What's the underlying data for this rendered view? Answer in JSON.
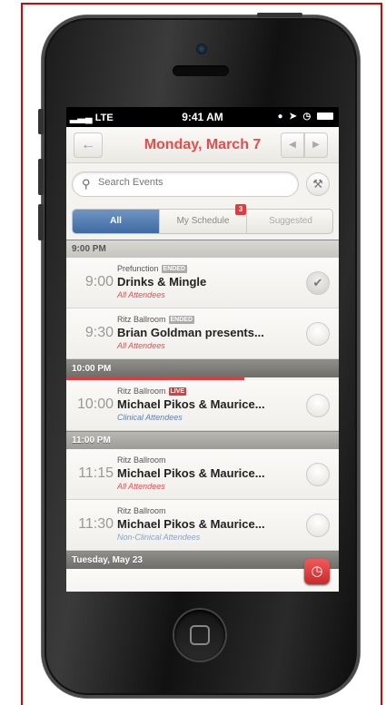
{
  "statusbar": {
    "carrier": "LTE",
    "time": "9:41 AM"
  },
  "header": {
    "back": "←",
    "title": "Monday, March 7",
    "prev": "◀",
    "next": "▶"
  },
  "search": {
    "placeholder": "Search Events"
  },
  "tabs": [
    {
      "label": "All",
      "active": true
    },
    {
      "label": "My Schedule",
      "badge": "3"
    },
    {
      "label": "Suggested"
    }
  ],
  "sections": [
    {
      "header": "9:00 PM",
      "events": [
        {
          "time": "9:00",
          "venue": "Prefunction",
          "tag": "ENDED",
          "title": "Drinks & Mingle",
          "audience": "All Attendees",
          "audience_color": "#e94b4b",
          "checked": true
        },
        {
          "time": "9:30",
          "venue": "Ritz Ballroom",
          "tag": "ENDED",
          "title": "Brian Goldman presents...",
          "audience": "All Attendees",
          "audience_color": "#e94b4b",
          "checked": false
        }
      ]
    },
    {
      "header": "10:00 PM",
      "events": [
        {
          "time": "10:00",
          "venue": "Ritz Ballroom",
          "tag": "LIVE",
          "title": "Michael Pikos & Maurice...",
          "audience": "Clinical Attendees",
          "audience_color": "#5b7fb5",
          "checked": false
        }
      ]
    },
    {
      "header": "11:00 PM",
      "events": [
        {
          "time": "11:15",
          "venue": "Ritz Ballroom",
          "tag": "",
          "title": "Michael Pikos & Maurice...",
          "audience": "All Attendees",
          "audience_color": "#e94b4b",
          "checked": false
        },
        {
          "time": "11:30",
          "venue": "Ritz Ballroom",
          "tag": "",
          "title": "Michael Pikos & Maurice...",
          "audience": "Non-Clinical Attendees",
          "audience_color": "#8aa3c8",
          "checked": false
        }
      ]
    },
    {
      "header": "Tuesday, May 23",
      "events": []
    }
  ],
  "colors": {
    "accent": "#e94b4b",
    "live": "#e23b3b",
    "tab_active": "#4f78ad"
  }
}
